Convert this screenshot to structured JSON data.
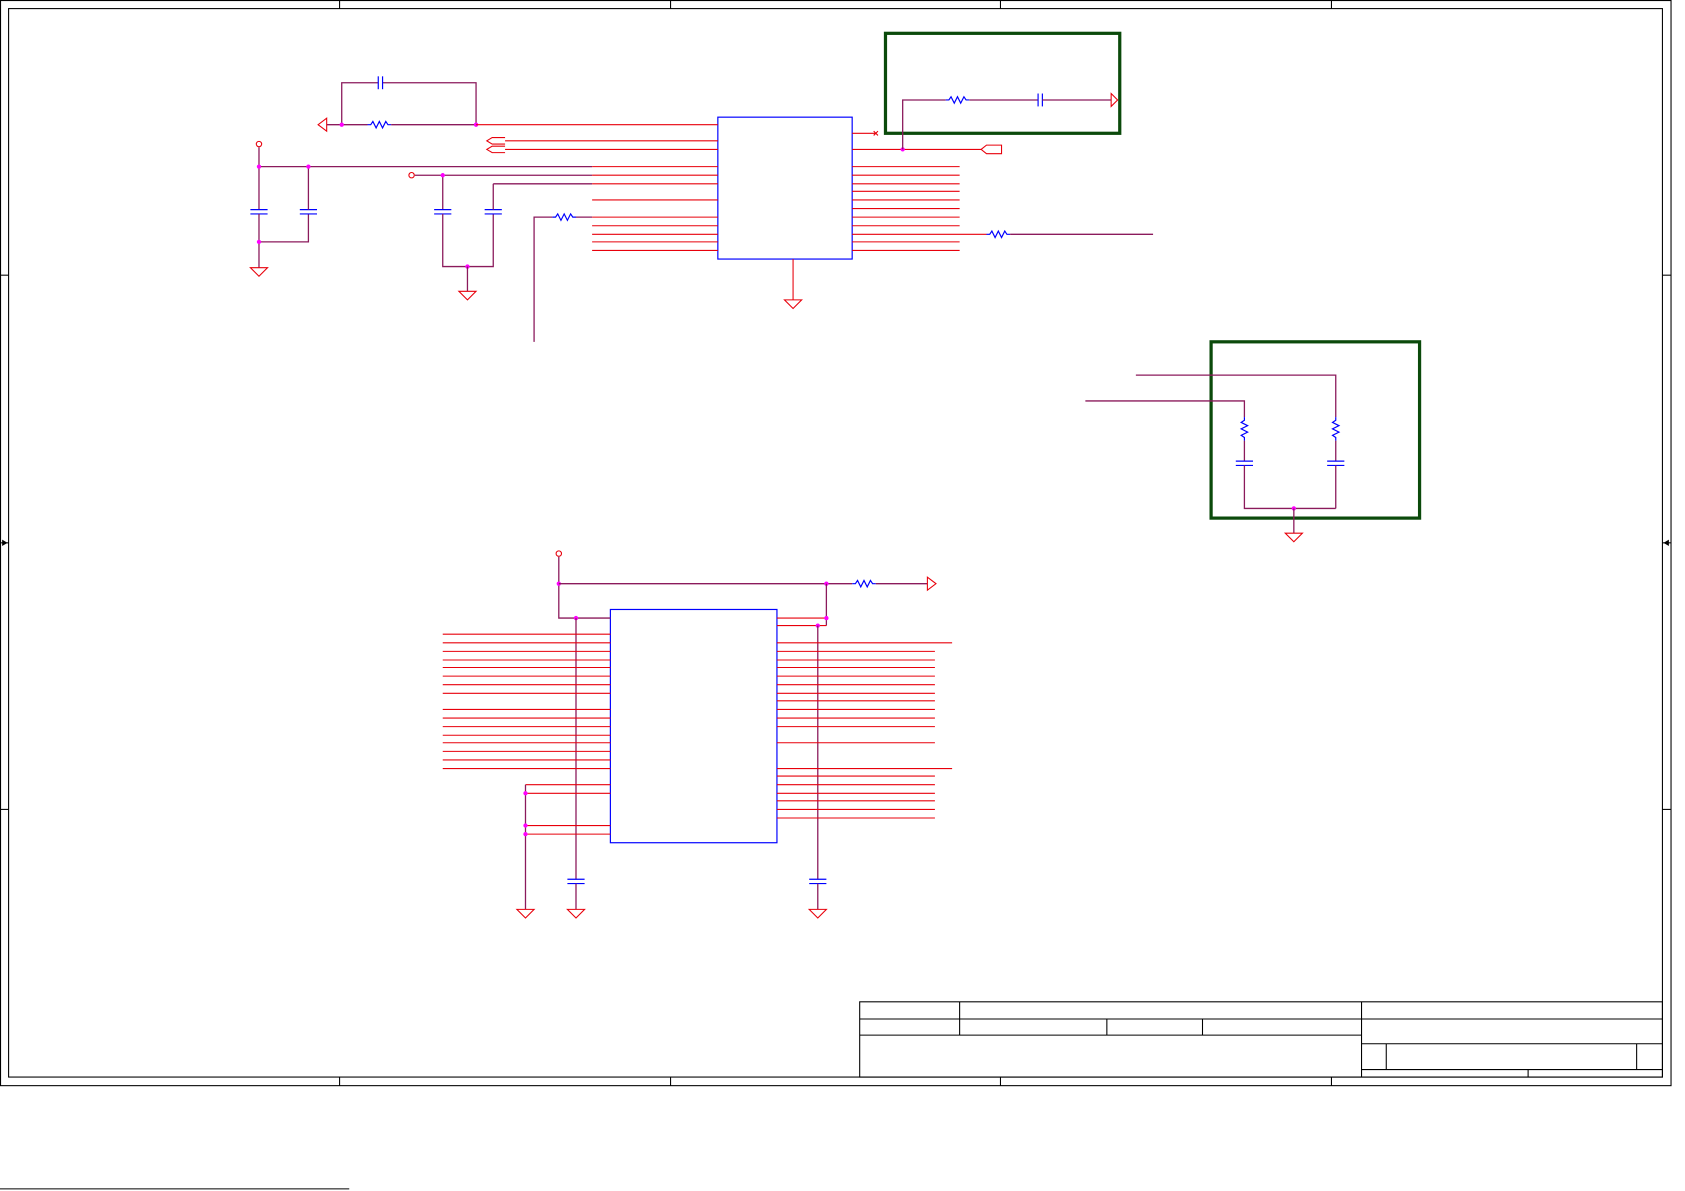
{
  "colors": {
    "pin": "#e8000b",
    "wire": "#8b1a5c",
    "part": "#0000ff",
    "junction": "#ff00ff",
    "highlight_box": "#0b4a0b",
    "frame": "#000000"
  }
}
